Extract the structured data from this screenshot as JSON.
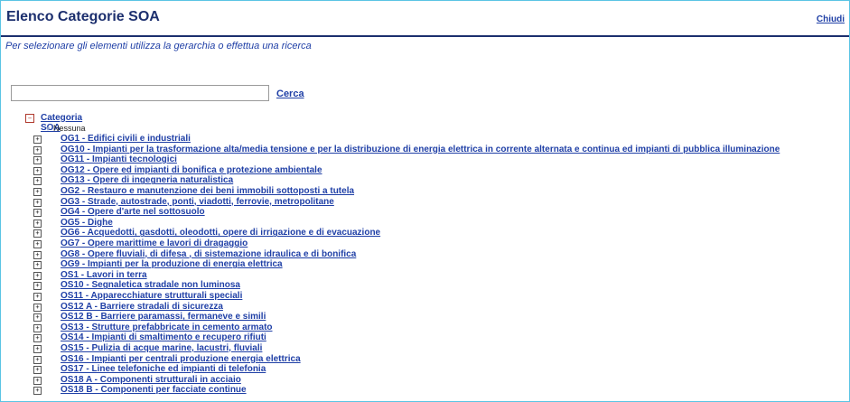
{
  "header": {
    "title": "Elenco Categorie SOA",
    "close_label": "Chiudi"
  },
  "instructions": "Per selezionare gli elementi utilizza la gerarchia o effettua una ricerca",
  "search": {
    "value": "",
    "placeholder": "",
    "button_label": "Cerca"
  },
  "tree": {
    "root_label": "Categoria SOA",
    "none_label": "Nessuna",
    "items": [
      "OG1 - Edifici civili e industriali",
      "OG10 - Impianti per la trasformazione alta/media tensione e per la distribuzione di energia elettrica in corrente alternata e continua ed impianti di pubblica illuminazione",
      "OG11 - Impianti tecnologici",
      "OG12 - Opere ed impianti di bonifica e protezione ambientale",
      "OG13 - Opere di ingegneria naturalistica",
      "OG2 - Restauro e manutenzione dei beni immobili sottoposti a tutela",
      "OG3 - Strade, autostrade, ponti, viadotti, ferrovie, metropolitane",
      "OG4 - Opere d'arte nel sottosuolo",
      "OG5 - Dighe",
      "OG6 - Acquedotti, gasdotti, oleodotti, opere di irrigazione e di evacuazione",
      "OG7 - Opere marittime e lavori di dragaggio",
      "OG8 - Opere fluviali, di difesa , di sistemazione idraulica e di bonifica",
      "OG9 - Impianti per la produzione di energia elettrica",
      "OS1 - Lavori in terra",
      "OS10 - Segnaletica stradale non luminosa",
      "OS11 - Apparecchiature strutturali speciali",
      "OS12 A - Barriere stradali di sicurezza",
      "OS12 B - Barriere paramassi, fermaneve e simili",
      "OS13 - Strutture prefabbricate in cemento armato",
      "OS14 - Impianti di smaltimento e recupero rifiuti",
      "OS15 - Pulizia di acque marine, lacustri, fluviali",
      "OS16 - Impianti per centrali produzione energia elettrica",
      "OS17 - Linee telefoniche ed impianti di telefonia",
      "OS18 A - Componenti strutturali in acciaio",
      "OS18 B - Componenti per facciate continue"
    ]
  }
}
